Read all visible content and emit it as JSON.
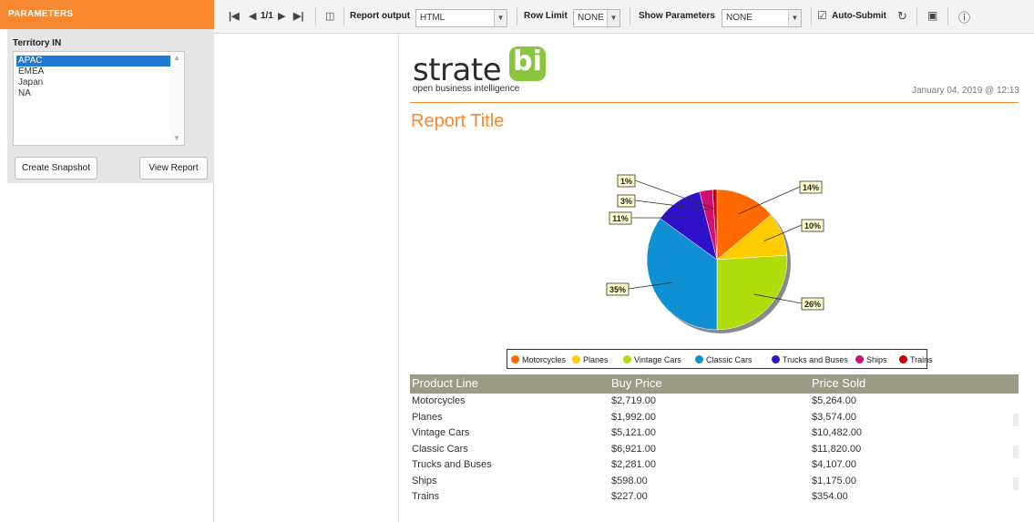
{
  "parameters": {
    "header": "PARAMETERS",
    "territory_label": "Territory IN",
    "territories": [
      "APAC",
      "EMEA",
      "Japan",
      "NA"
    ],
    "selected": "APAC",
    "create_snapshot": "Create Snapshot",
    "view_report": "View Report"
  },
  "toolbar": {
    "page_indicator": "1/1",
    "report_output_label": "Report output",
    "report_output_value": "HTML",
    "row_limit_label": "Row Limit",
    "row_limit_value": "NONE",
    "show_parameters_label": "Show Parameters",
    "show_parameters_value": "NONE",
    "auto_submit_label": "Auto-Submit",
    "auto_submit_checked": true
  },
  "report": {
    "logo_word": "strate",
    "logo_bi": "bi",
    "logo_tagline": "open business intelligence",
    "date": "January 04, 2019 @ 12:13",
    "title": "Report Title"
  },
  "chart_data": {
    "type": "pie",
    "labels": [
      "Motorcycles",
      "Planes",
      "Vintage Cars",
      "Classic Cars",
      "Trucks and Buses",
      "Ships",
      "Trains"
    ],
    "values": [
      14,
      10,
      26,
      35,
      11,
      3,
      1
    ],
    "percent_labels": [
      "14%",
      "10%",
      "26%",
      "35%",
      "11%",
      "3%",
      "1%"
    ],
    "colors": [
      "#ff6a00",
      "#ffcc00",
      "#b0dc0b",
      "#0f90d2",
      "#3010c8",
      "#d01070",
      "#c80000"
    ],
    "legend_position": "bottom"
  },
  "table": {
    "headers": [
      "Product Line",
      "Buy Price",
      "Price Sold"
    ],
    "rows": [
      [
        "Motorcycles",
        "$2,719.00",
        "$5,264.00"
      ],
      [
        "Planes",
        "$1,992.00",
        "$3,574.00"
      ],
      [
        "Vintage Cars",
        "$5,121.00",
        "$10,482.00"
      ],
      [
        "Classic Cars",
        "$6,921.00",
        "$11,820.00"
      ],
      [
        "Trucks and Buses",
        "$2,281.00",
        "$4,107.00"
      ],
      [
        "Ships",
        "$598.00",
        "$1,175.00"
      ],
      [
        "Trains",
        "$227.00",
        "$354.00"
      ]
    ]
  }
}
